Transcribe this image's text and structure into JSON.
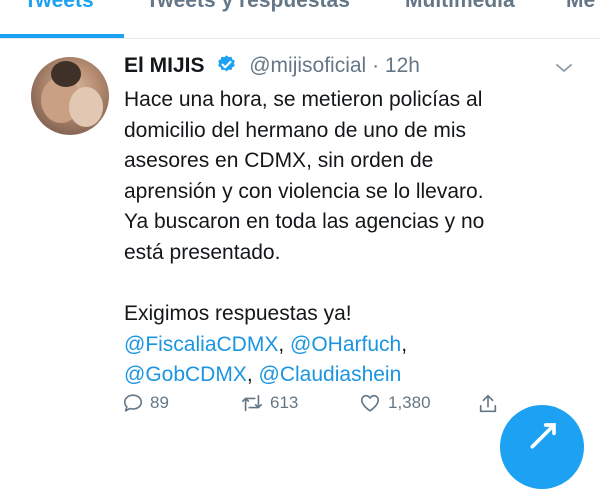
{
  "tabs": [
    {
      "label": "Tweets"
    },
    {
      "label": "Tweets y respuestas"
    },
    {
      "label": "Multimedia"
    },
    {
      "label": "Me"
    }
  ],
  "tweet": {
    "author_name": "El MIJIS",
    "handle": "@mijisoficial",
    "separator": "·",
    "time": "12h",
    "body_lines": [
      "Hace una hora, se metieron policías al",
      "domicilio del hermano de uno de mis",
      "asesores en CDMX, sin orden de",
      "aprensión y con violencia se lo llevaro.",
      "Ya buscaron en toda las agencias y no",
      "está presentado.",
      "",
      "Exigimos respuestas ya!"
    ],
    "mentions": {
      "m1": "@FiscaliaCDMX",
      "m2": "@OHarfuch",
      "m3": "@GobCDMX",
      "m4": "@Claudiashein",
      "comma": ","
    },
    "stats": {
      "replies": "89",
      "retweets": "613",
      "likes": "1,380"
    }
  },
  "colors": {
    "accent": "#1da1f2",
    "link": "#1b95e0",
    "muted": "#657786",
    "text": "#14171a"
  },
  "icons": [
    "verified-badge-icon",
    "chevron-down-icon",
    "reply-icon",
    "retweet-icon",
    "like-icon",
    "share-icon",
    "compose-icon"
  ]
}
